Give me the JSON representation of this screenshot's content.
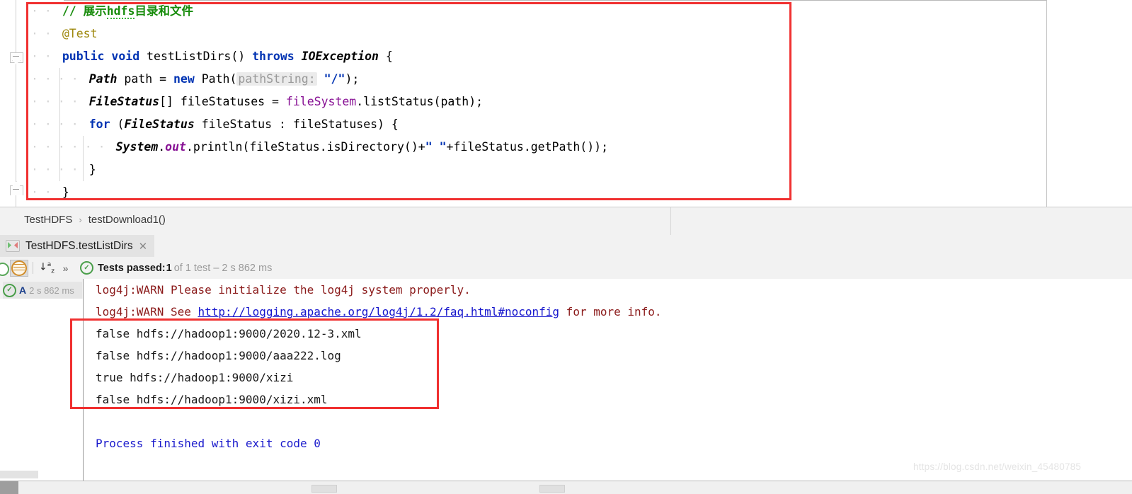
{
  "editor": {
    "code_lines": [
      {
        "indent": 0,
        "tokens": [
          {
            "t": "// 展示hdfs目录和文件",
            "c": "cmt"
          }
        ]
      },
      {
        "indent": 0,
        "tokens": [
          {
            "t": "@Test",
            "c": "anno"
          }
        ]
      },
      {
        "indent": 0,
        "tokens": [
          {
            "t": "public",
            "c": "kw"
          },
          {
            "t": " ",
            "c": "ws"
          },
          {
            "t": "void",
            "c": "kw"
          },
          {
            "t": " ",
            "c": "ws"
          },
          {
            "t": "testListDirs() ",
            "c": "plain"
          },
          {
            "t": "throws",
            "c": "kw"
          },
          {
            "t": " ",
            "c": "ws"
          },
          {
            "t": "IOException",
            "c": "type"
          },
          {
            "t": " {",
            "c": "plain"
          }
        ]
      },
      {
        "indent": 1,
        "tokens": [
          {
            "t": "Path",
            "c": "type"
          },
          {
            "t": " path = ",
            "c": "plain"
          },
          {
            "t": "new",
            "c": "kw"
          },
          {
            "t": " Path(",
            "c": "plain"
          },
          {
            "t": "pathString:",
            "c": "hint"
          },
          {
            "t": " ",
            "c": "plain"
          },
          {
            "t": "\"/\"",
            "c": "str"
          },
          {
            "t": ");",
            "c": "plain"
          }
        ]
      },
      {
        "indent": 1,
        "tokens": [
          {
            "t": "FileStatus",
            "c": "type"
          },
          {
            "t": "[] fileStatuses = ",
            "c": "plain"
          },
          {
            "t": "fileSystem",
            "c": "fld"
          },
          {
            "t": ".listStatus(path);",
            "c": "plain"
          }
        ]
      },
      {
        "indent": 1,
        "tokens": [
          {
            "t": "for",
            "c": "kw"
          },
          {
            "t": " (",
            "c": "plain"
          },
          {
            "t": "FileStatus",
            "c": "type"
          },
          {
            "t": " fileStatus : fileStatuses) {",
            "c": "plain"
          }
        ]
      },
      {
        "indent": 2,
        "tokens": [
          {
            "t": "System",
            "c": "type"
          },
          {
            "t": ".",
            "c": "plain"
          },
          {
            "t": "out",
            "c": "stat"
          },
          {
            "t": ".println(fileStatus.isDirectory()+",
            "c": "plain"
          },
          {
            "t": "\" \"",
            "c": "str"
          },
          {
            "t": "+fileStatus.getPath());",
            "c": "plain"
          }
        ]
      },
      {
        "indent": 1,
        "tokens": [
          {
            "t": "}",
            "c": "plain"
          }
        ]
      },
      {
        "indent": 0,
        "tokens": [
          {
            "t": "}",
            "c": "plain"
          }
        ]
      }
    ],
    "highlight_box_color": "#f03030"
  },
  "breadcrumb": {
    "items": [
      "TestHDFS",
      "testDownload1()"
    ],
    "separator": "›"
  },
  "test_tab": {
    "label": "TestHDFS.testListDirs",
    "close_label": "✕",
    "icon": "run-config-icon"
  },
  "test_toolbar": {
    "filter_icon": "filter-icon",
    "sort_icon": "sort-alphabetically-icon",
    "expand_icon": "»",
    "status_icon": "success-check-icon",
    "status_prefix": "Tests passed: ",
    "status_count": "1",
    "status_suffix": " of 1 test – 2 s 862 ms"
  },
  "test_tree": {
    "node_icon": "success-check-icon",
    "node_label": "A",
    "node_duration": "2 s 862 ms"
  },
  "console": {
    "lines": [
      {
        "cls": "warnc",
        "text": "log4j:WARN Please initialize the log4j system properly."
      },
      {
        "cls": "warnc",
        "text": "log4j:WARN See ",
        "link": "http://logging.apache.org/log4j/1.2/faq.html#noconfig",
        "tail": " for more info."
      },
      {
        "cls": "outc",
        "text": "false hdfs://hadoop1:9000/2020.12-3.xml"
      },
      {
        "cls": "outc",
        "text": "false hdfs://hadoop1:9000/aaa222.log"
      },
      {
        "cls": "outc",
        "text": "true hdfs://hadoop1:9000/xizi"
      },
      {
        "cls": "outc",
        "text": "false hdfs://hadoop1:9000/xizi.xml"
      },
      {
        "cls": "outc",
        "text": ""
      },
      {
        "cls": "procc",
        "text": "Process finished with exit code 0"
      }
    ],
    "highlight_box_color": "#f03030"
  },
  "watermark": {
    "text": "https://blog.csdn.net/weixin_45480785"
  },
  "colors": {
    "accent_red": "#f03030",
    "keyword_blue": "#0033b3",
    "comment_green": "#178c0b",
    "field_purple": "#871094",
    "annotation_yellow": "#9e880d",
    "warn_dark_red": "#8b1a1a",
    "link_blue": "#1414cc",
    "process_blue": "#1a1acc",
    "pass_green": "#4a9e4a"
  }
}
